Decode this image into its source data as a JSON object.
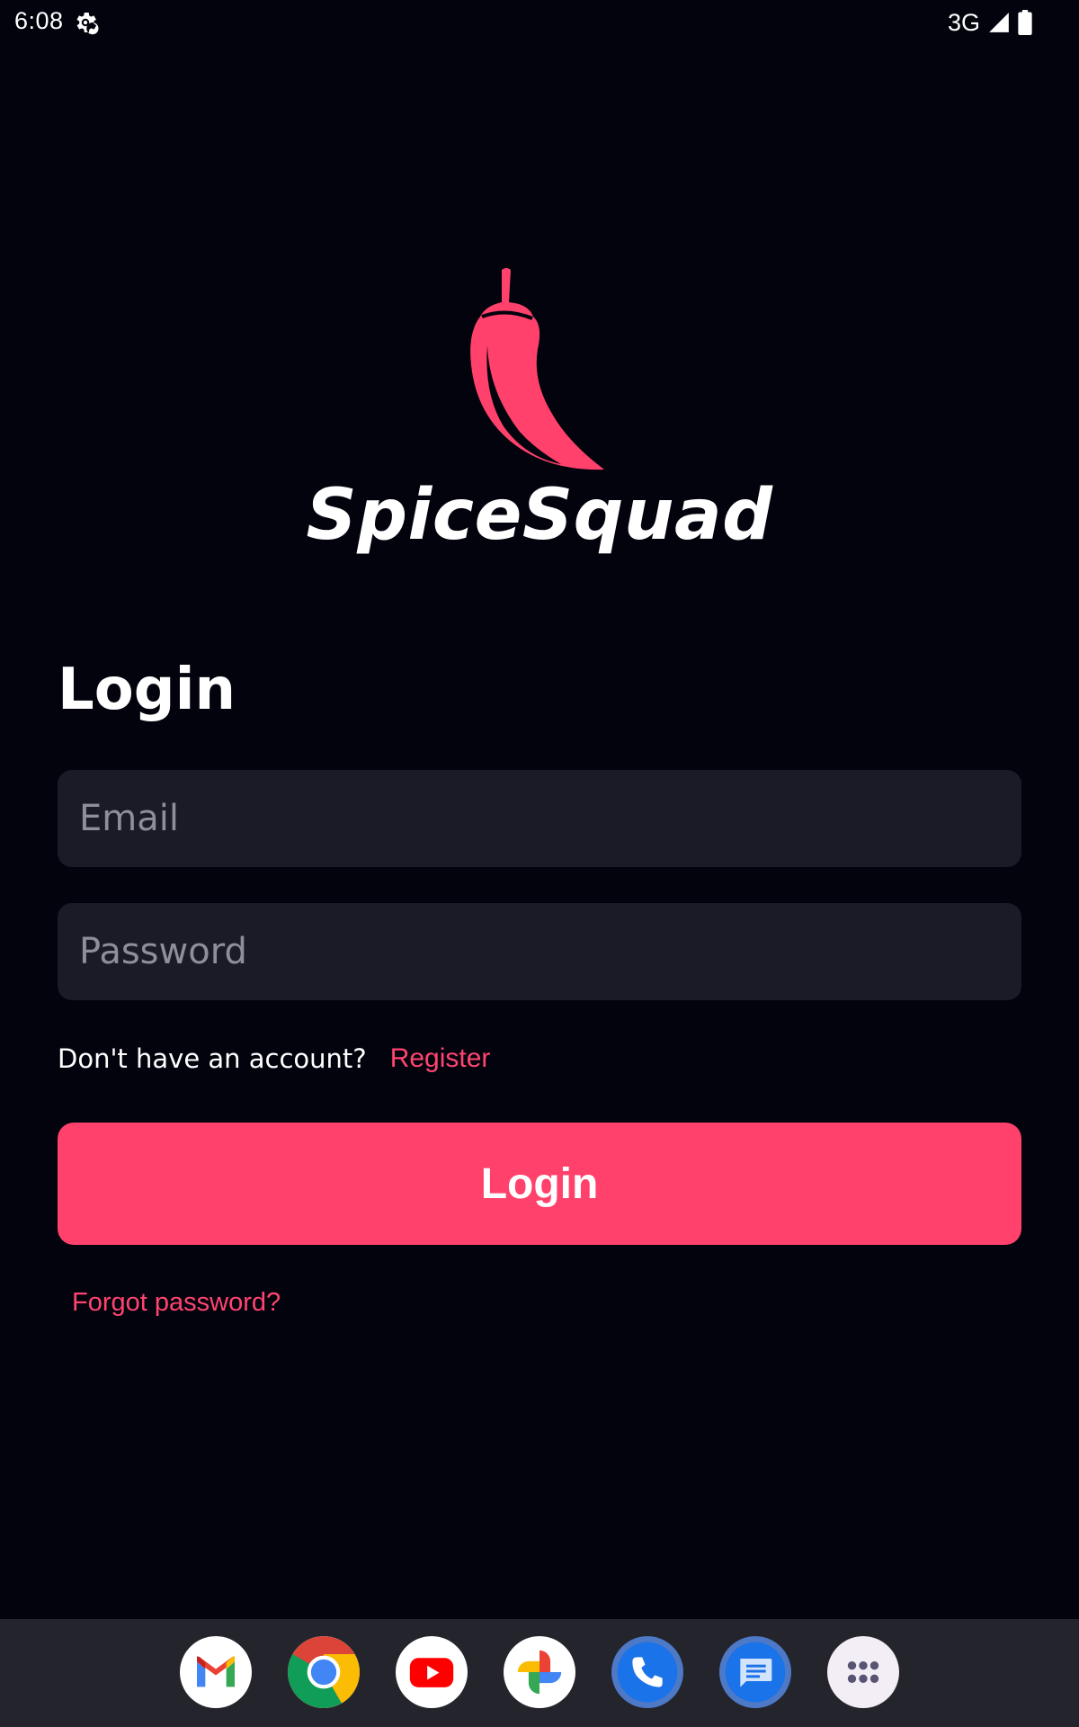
{
  "status_bar": {
    "time": "6:08",
    "network": "3G",
    "icons": [
      "settings-gear-icon",
      "cellular-signal-icon",
      "battery-icon"
    ]
  },
  "brand": {
    "name": "SpiceSquad",
    "logo_icon": "chili-pepper-icon",
    "accent_color": "#ff416c"
  },
  "login_form": {
    "heading": "Login",
    "email_placeholder": "Email",
    "email_value": "",
    "password_placeholder": "Password",
    "password_value": "",
    "account_prompt": "Don't have an account?",
    "register_label": "Register",
    "submit_label": "Login",
    "forgot_label": "Forgot password?"
  },
  "dock": {
    "apps": [
      {
        "name": "gmail",
        "icon": "gmail-icon"
      },
      {
        "name": "chrome",
        "icon": "chrome-icon"
      },
      {
        "name": "youtube",
        "icon": "youtube-icon"
      },
      {
        "name": "photos",
        "icon": "photos-pinwheel-icon"
      },
      {
        "name": "phone",
        "icon": "phone-icon"
      },
      {
        "name": "messages",
        "icon": "messages-icon"
      },
      {
        "name": "app-drawer",
        "icon": "app-grid-icon"
      }
    ]
  }
}
